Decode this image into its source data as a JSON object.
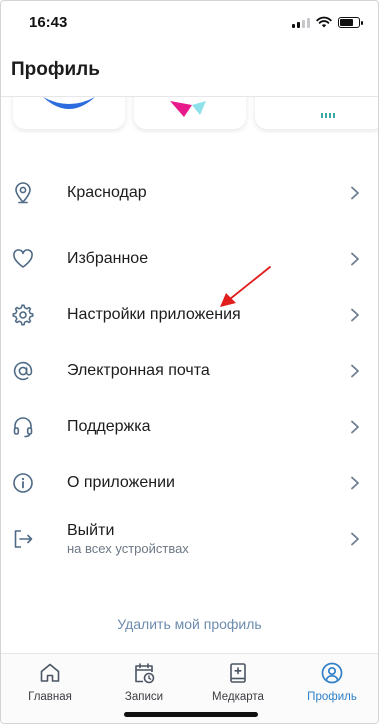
{
  "status_bar": {
    "time": "16:43"
  },
  "header": {
    "title": "Профиль"
  },
  "menu": {
    "items": [
      {
        "label": "Краснодар",
        "sub": "",
        "icon": "location-pin-icon"
      },
      {
        "label": "Избранное",
        "sub": "",
        "icon": "heart-icon"
      },
      {
        "label": "Настройки приложения",
        "sub": "",
        "icon": "gear-icon"
      },
      {
        "label": "Электронная почта",
        "sub": "",
        "icon": "at-sign-icon"
      },
      {
        "label": "Поддержка",
        "sub": "",
        "icon": "headset-icon"
      },
      {
        "label": "О приложении",
        "sub": "",
        "icon": "info-icon"
      },
      {
        "label": "Выйти",
        "sub": "на всех устройствах",
        "icon": "logout-icon"
      }
    ]
  },
  "delete_profile": {
    "label": "Удалить мой профиль"
  },
  "tabbar": {
    "tabs": [
      {
        "label": "Главная",
        "icon": "home-icon",
        "active": false
      },
      {
        "label": "Записи",
        "icon": "calendar-clock-icon",
        "active": false
      },
      {
        "label": "Медкарта",
        "icon": "medical-book-icon",
        "active": false
      },
      {
        "label": "Профиль",
        "icon": "profile-icon",
        "active": true
      }
    ]
  },
  "colors": {
    "accent": "#2f80c9",
    "icon": "#4e6a86",
    "annotation_arrow": "#e11d1d"
  }
}
